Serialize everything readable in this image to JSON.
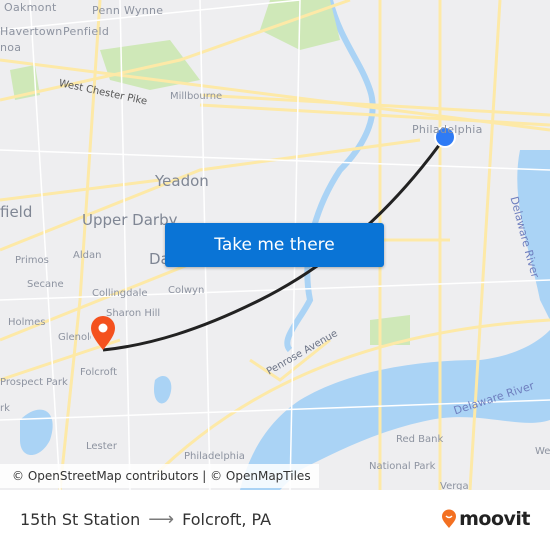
{
  "map": {
    "labels": [
      {
        "text": "Oakmont",
        "cls": "med"
      },
      {
        "text": "Penn Wynne",
        "cls": "med"
      },
      {
        "text": "Havertown",
        "cls": "med"
      },
      {
        "text": "Penfield",
        "cls": "med"
      },
      {
        "text": "noa",
        "cls": "med"
      },
      {
        "text": "West Chester Pike",
        "cls": "sm"
      },
      {
        "text": "Millbourne",
        "cls": "sm"
      },
      {
        "text": "Philadelphia",
        "cls": "med"
      },
      {
        "text": "Yeadon",
        "cls": "big"
      },
      {
        "text": "field",
        "cls": "big"
      },
      {
        "text": "Upper Darby",
        "cls": "big"
      },
      {
        "text": "Da",
        "cls": "big"
      },
      {
        "text": "Primos",
        "cls": "sm"
      },
      {
        "text": "Aldan",
        "cls": "sm"
      },
      {
        "text": "Secane",
        "cls": "sm"
      },
      {
        "text": "Collingdale",
        "cls": "sm"
      },
      {
        "text": "Colwyn",
        "cls": "sm"
      },
      {
        "text": "Holmes",
        "cls": "sm"
      },
      {
        "text": "Sharon Hill",
        "cls": "sm"
      },
      {
        "text": "Glenolden",
        "cls": "sm"
      },
      {
        "text": "Folcroft",
        "cls": "sm"
      },
      {
        "text": "Prospect Park",
        "cls": "sm"
      },
      {
        "text": "rk",
        "cls": "sm"
      },
      {
        "text": "Penrose Avenue",
        "cls": "sm"
      },
      {
        "text": "Delaware River",
        "cls": "water"
      },
      {
        "text": "Delaware River",
        "cls": "water"
      },
      {
        "text": "Red Bank",
        "cls": "sm"
      },
      {
        "text": "National Park",
        "cls": "sm"
      },
      {
        "text": "Lester",
        "cls": "sm"
      },
      {
        "text": "Philadelphia",
        "cls": "sm"
      },
      {
        "text": "Verga",
        "cls": "sm"
      },
      {
        "text": "We",
        "cls": "sm"
      }
    ],
    "origin_marker": {
      "name": "15th St Station",
      "color": "#2f7bf5"
    },
    "destination_marker": {
      "name": "Folcroft, PA",
      "color": "#f4511e"
    },
    "route_color": "#222222",
    "attribution": "© OpenStreetMap contributors | © OpenMapTiles"
  },
  "cta": {
    "label": "Take me there",
    "color": "#0a74d6"
  },
  "footer": {
    "origin": "15th St Station",
    "arrow": "⟶",
    "destination": "Folcroft, PA",
    "brand": "moovit",
    "brand_color": "#f37021"
  }
}
